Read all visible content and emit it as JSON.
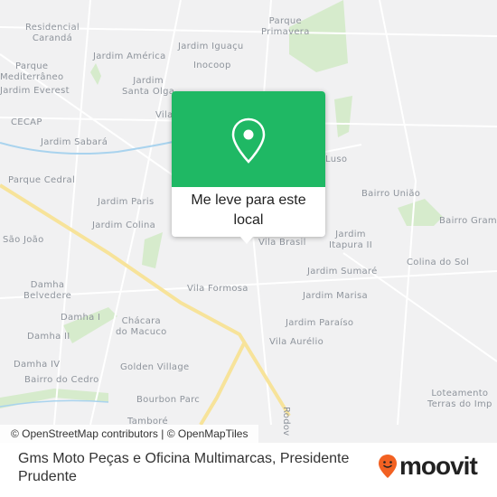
{
  "map": {
    "labels": [
      "Residencial\nCarandá",
      "Parque\nMediterrâneo",
      "Jardim Everest",
      "CECAP",
      "Jardim Sabará",
      "Parque Cedral",
      "São João",
      "Jardim América",
      "Jardim Iguaçu",
      "Inocoop",
      "Jardim\nSanta Olga",
      "Vila",
      "Parque\nPrimavera",
      "Luso",
      "Bairro União",
      "Bairro Gram",
      "Jardim Paris",
      "Jardim Colina",
      "Vila Brasil",
      "Jardim\nItapura II",
      "Jardim Sumaré",
      "Colina do Sol",
      "Damha\nBelvedere",
      "Vila Formosa",
      "Jardim Marisa",
      "Damha I",
      "Chácara\ndo Macuco",
      "Jardim Paraíso",
      "Damha II",
      "Vila Aurélio",
      "Damha IV",
      "Golden Village",
      "Bairro do Cedro",
      "Bourbon Parc",
      "Tamboré",
      "Loteamento\nTerras do Imp",
      "Rodov"
    ],
    "colors": {
      "background": "#f1f1f2",
      "park": "#d6ebcc",
      "highway": "#f7e39a",
      "water": "#a9d3ee"
    }
  },
  "popup": {
    "icon": "location-pin-icon",
    "label": "Me leve para este local",
    "color": "#1fb864"
  },
  "attribution": "© OpenStreetMap contributors | © OpenMapTiles",
  "footer": {
    "title": "Gms Moto Peças e Oficina Multimarcas, Presidente Prudente",
    "logo": "moovit",
    "brand_color": "#f26122"
  }
}
